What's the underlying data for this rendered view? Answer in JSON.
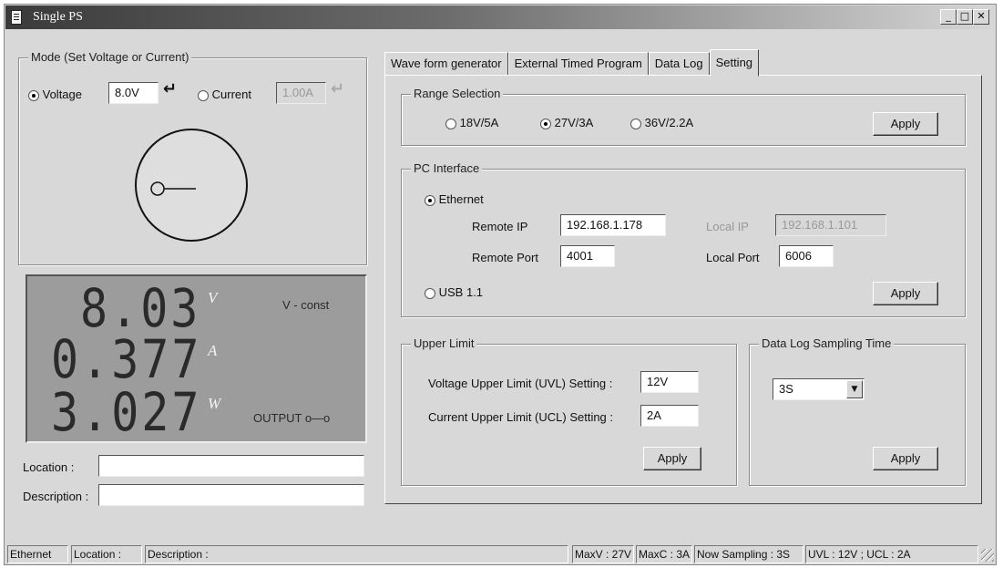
{
  "window": {
    "title": "Single PS"
  },
  "mode": {
    "legend": "Mode (Set Voltage or Current)",
    "voltage_label": "Voltage",
    "voltage_value": "8.0V",
    "current_label": "Current",
    "current_value": "1.00A",
    "selected": "voltage"
  },
  "display": {
    "voltage": "8.03",
    "voltage_unit": "V",
    "current": "0.377",
    "current_unit": "A",
    "power": "3.027",
    "power_unit": "W",
    "mode_text": "V - const",
    "output_text": "OUTPUT o—o"
  },
  "info": {
    "location_label": "Location :",
    "location_value": "",
    "description_label": "Description :",
    "description_value": ""
  },
  "tabs": [
    {
      "label": "Wave form generator",
      "active": false
    },
    {
      "label": "External Timed Program",
      "active": false
    },
    {
      "label": "Data Log",
      "active": false
    },
    {
      "label": "Setting",
      "active": true
    }
  ],
  "range": {
    "legend": "Range Selection",
    "options": [
      "18V/5A",
      "27V/3A",
      "36V/2.2A"
    ],
    "selected": "27V/3A",
    "apply": "Apply"
  },
  "pc_interface": {
    "legend": "PC Interface",
    "ethernet_label": "Ethernet",
    "remote_ip_label": "Remote IP",
    "remote_ip": "192.168.1.178",
    "remote_port_label": "Remote Port",
    "remote_port": "4001",
    "local_ip_label": "Local IP",
    "local_ip": "192.168.1.101",
    "local_port_label": "Local Port",
    "local_port": "6006",
    "usb_label": "USB 1.1",
    "selected": "ethernet",
    "apply": "Apply"
  },
  "upper_limit": {
    "legend": "Upper Limit",
    "uvl_label": "Voltage Upper Limit (UVL) Setting :",
    "uvl_value": "12V",
    "ucl_label": "Current Upper Limit (UCL) Setting :",
    "ucl_value": "2A",
    "apply": "Apply"
  },
  "sampling": {
    "legend": "Data Log Sampling Time",
    "value": "3S",
    "apply": "Apply"
  },
  "statusbar": {
    "interface": "Ethernet",
    "location": "Location :",
    "description": "Description :",
    "max_v": "MaxV : 27V",
    "max_c": "MaxC : 3A",
    "sampling": "Now Sampling : 3S",
    "limits": "UVL : 12V ; UCL : 2A"
  }
}
